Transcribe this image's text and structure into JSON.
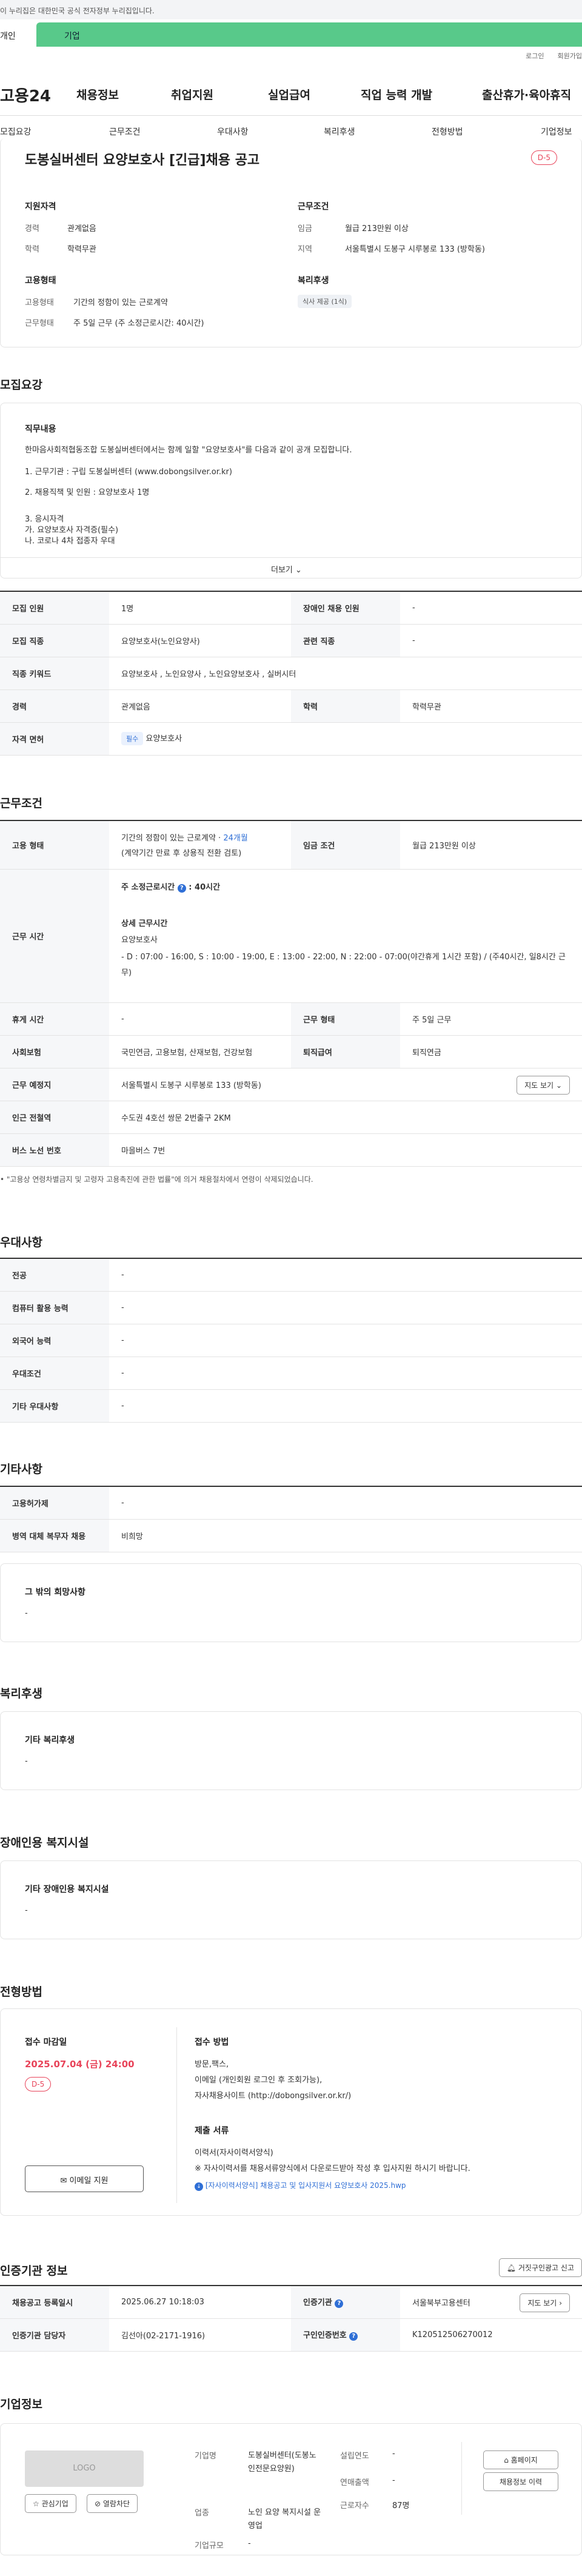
{
  "notice": "이 누리집은 대한민국 공식 전자정부 누리집입니다.",
  "tabs": [
    "개인",
    "기업"
  ],
  "util": [
    "로그인",
    "회원가입"
  ],
  "logo": "고용24",
  "gnb": [
    "채용정보",
    "취업지원",
    "실업급여",
    "직업 능력 개발",
    "출산휴가·육아휴직"
  ],
  "snb": [
    "모집요강",
    "근무조건",
    "우대사항",
    "복리후생",
    "전형방법",
    "기업정보"
  ],
  "job": {
    "title": "도봉실버센터 요양보호사 [긴급]채용 공고",
    "dday": "D-5",
    "qual_h": "지원자격",
    "career_l": "경력",
    "career_v": "관계없음",
    "edu_l": "학력",
    "edu_v": "학력무관",
    "cond_h": "근무조건",
    "wage_l": "임금",
    "wage_v": "월급 213만원 이상",
    "region_l": "지역",
    "region_v": "서울특별시 도봉구 시루봉로 133 (방학동)",
    "emp_h": "고용형태",
    "emp_l": "고용형태",
    "emp_v": "기간의 정함이 있는 근로계약",
    "worktype_l": "근무형태",
    "worktype_v": "주 5일 근무 (주 소정근로시간: 40시간)",
    "welfare_h": "복리후생",
    "welfare_badge": "식사 제공 (1식)"
  },
  "recruit": {
    "h": "모집요강",
    "duty_h": "직무내용",
    "lines": [
      "한마음사회적협동조합 도봉실버센터에서는 함께 일할 \"요양보호사\"를 다음과 같이 공개 모집합니다.",
      "1. 근무기관 : 구립 도봉실버센터 (www.dobongsilver.or.kr)",
      "2. 채용직책 및 인원 : 요양보호사 1명",
      "3. 응시자격",
      "가. 요양보호사 자격증(필수)",
      "나. 코로나 4차 접종자 우대"
    ],
    "more": "더보기",
    "rows": [
      [
        "모집 인원",
        "1명",
        "장애인 채용 인원",
        "-"
      ],
      [
        "모집 직종",
        "요양보호사(노인요양사)",
        "관련 직종",
        "-"
      ],
      [
        "직종 키워드",
        "요양보호사 , 노인요양사 , 노인요양보호사 , 실버시터",
        "",
        ""
      ],
      [
        "경력",
        "관계없음",
        "학력",
        "학력무관"
      ]
    ],
    "license_l": "자격 면허",
    "license_badge": "필수",
    "license_v": "요양보호사"
  },
  "work": {
    "h": "근무조건",
    "emp_l": "고용 형태",
    "emp_v1": "기간의 정함이 있는 근로계약 · ",
    "emp_v1b": "24개월",
    "emp_v2": "(계약기간 만료 후 상용직 전환 검토)",
    "wage_l": "임금 조건",
    "wage_v": "월급 213만원 이상",
    "time_l": "근무 시간",
    "time_a": "주 소정근로시간",
    "time_a2": "40시간",
    "time_b": "상세 근무시간",
    "time_c": "요양보호사",
    "time_d": "- D : 07:00 - 16:00, S : 10:00 - 19:00, E : 13:00 - 22:00, N : 22:00 - 07:00(야간휴게 1시간 포함) / (주40시간, 일8시간 근무)",
    "rows": [
      [
        "휴게 시간",
        "-",
        "근무 형태",
        "주 5일 근무"
      ],
      [
        "사회보험",
        "국민연금, 고용보험, 산재보험, 건강보험",
        "퇴직급여",
        "퇴직연금"
      ]
    ],
    "place_l": "근무 예정지",
    "place_v": "서울특별시 도봉구 시루봉로 133 (방학동)",
    "map": "지도 보기",
    "sub_l": "인근 전철역",
    "sub_v": "수도권 4호선 쌍문 2번출구 2KM",
    "bus_l": "버스 노선 번호",
    "bus_v": "마을버스 7번",
    "note": "\"고용상 연령차별금지 및 고령자 고용촉진에 관한 법률\"에 의거 채용절차에서 연령이 삭제되었습니다."
  },
  "pref": {
    "h": "우대사항",
    "rows": [
      [
        "전공",
        "-"
      ],
      [
        "컴퓨터 활용 능력",
        "-"
      ],
      [
        "외국어 능력",
        "-"
      ],
      [
        "우대조건",
        "-"
      ],
      [
        "기타 우대사항",
        "-"
      ]
    ]
  },
  "etc": {
    "h": "기타사항",
    "rows": [
      [
        "고용허가제",
        "-"
      ],
      [
        "병역 대체 복무자 채용",
        "비희망"
      ]
    ],
    "hope_h": "그 밖의 희망사항",
    "hope_v": "-"
  },
  "benefit": {
    "h": "복리후생",
    "sub": "기타 복리후생",
    "v": "-"
  },
  "disab": {
    "h": "장애인용 복지시설",
    "sub": "기타 장애인용 복지시설",
    "v": "-"
  },
  "process": {
    "h": "전형방법",
    "deadline_h": "접수 마감일",
    "deadline_v": "2025.07.04 (금) 24:00",
    "dday": "D-5",
    "apply": "이메일 지원",
    "method_h": "접수 방법",
    "method_lines": [
      "방문,팩스,",
      "이메일 (개인회원 로그인 후 조회가능),",
      "자사채용사이트 (http://dobongsilver.or.kr/)"
    ],
    "docs_h": "제출 서류",
    "docs_lines": [
      "이력서(자사이력서양식)",
      "※ 자사이력서를 채용서류양식에서 다운로드받아 작성 후 입사지원 하시기 바랍니다."
    ],
    "file": "[자사이력서양식] 채용공고 및 입사지원서 요양보호사 2025.hwp"
  },
  "cert": {
    "h": "인증기관 정보",
    "report": "거짓구인광고 신고",
    "rows": [
      [
        "채용공고 등록일시",
        "2025.06.27 10:18:03",
        "인증기관",
        "서울북부고용센터"
      ],
      [
        "인증기관 담당자",
        "김선아(02-2171-1916)",
        "구인인증번호",
        "K120512506270012"
      ]
    ],
    "map": "지도 보기"
  },
  "company": {
    "h": "기업정보",
    "logo": "LOGO",
    "fav": "관심기업",
    "block": "열람차단",
    "name_l": "기업명",
    "name_v": "도봉실버센터(도봉노인전문요양원)",
    "ind_l": "업종",
    "ind_v": "노인 요양 복지시설 운영업",
    "size_l": "기업규모",
    "size_v": "-",
    "year_l": "설립연도",
    "year_v": "-",
    "sales_l": "연매출액",
    "sales_v": "-",
    "emp_l": "근로자수",
    "emp_v": "87명",
    "home": "홈페이지",
    "info": "채용정보 이력"
  }
}
